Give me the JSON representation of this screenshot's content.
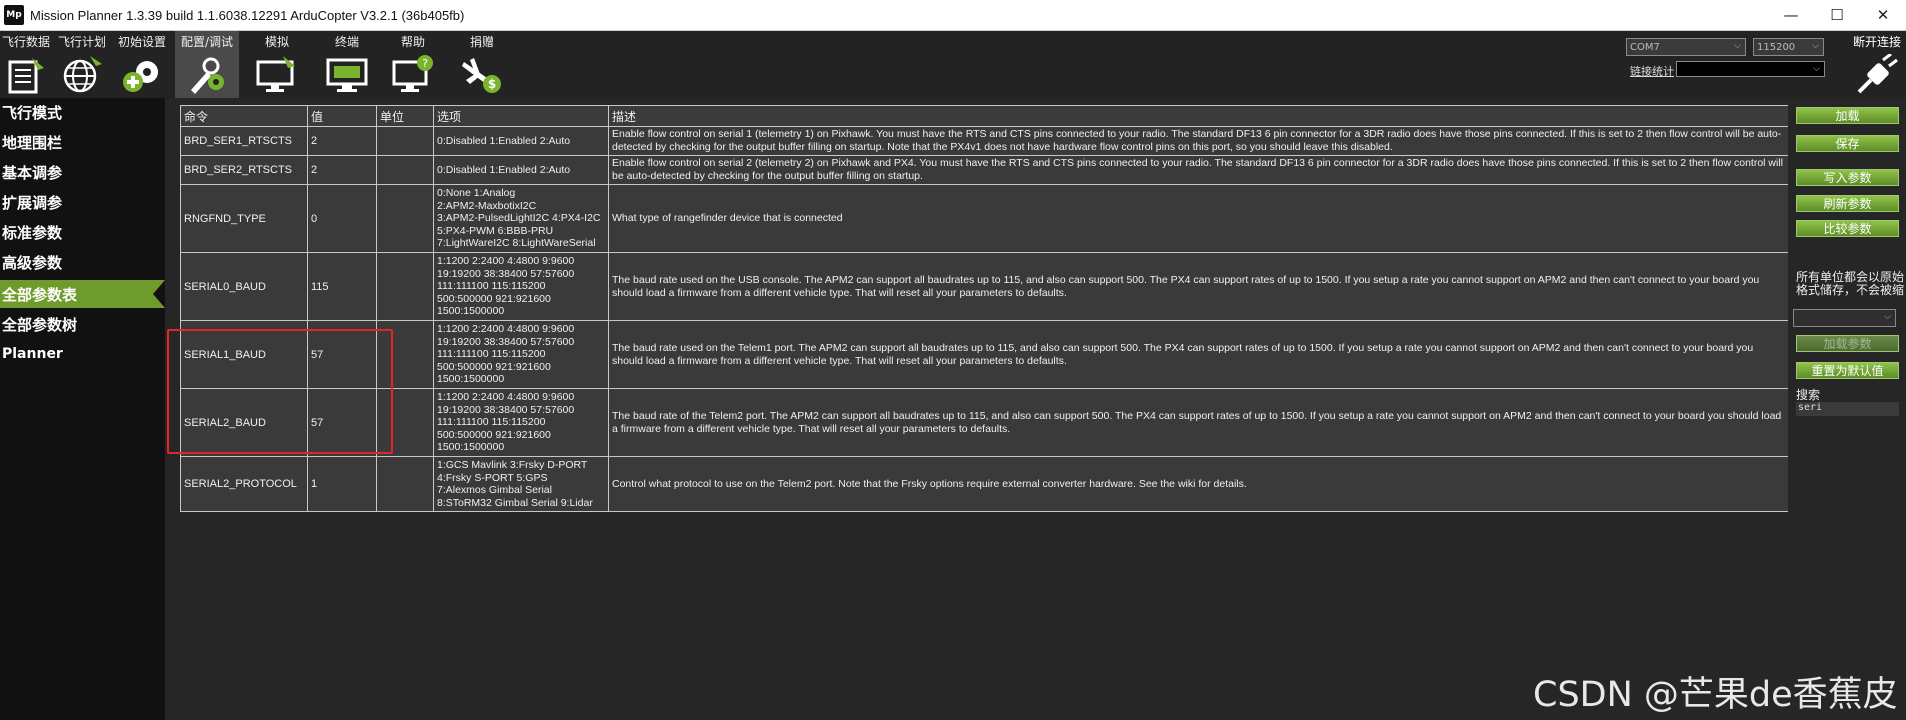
{
  "window": {
    "title": "Mission Planner 1.3.39 build 1.1.6038.12291 ArduCopter V3.2.1 (36b405fb)",
    "app_icon": "Mp",
    "minimize": "—",
    "maximize": "☐",
    "close": "✕"
  },
  "toolbar": {
    "items": [
      {
        "label": "飞行数据",
        "icon": "flight-data-icon"
      },
      {
        "label": "飞行计划",
        "icon": "globe-icon"
      },
      {
        "label": "初始设置",
        "icon": "gear-plus-icon"
      },
      {
        "label": "配置/调试",
        "icon": "wrench-gear-icon"
      },
      {
        "label": "模拟",
        "icon": "monitor-icon"
      },
      {
        "label": "终端",
        "icon": "terminal-icon"
      },
      {
        "label": "帮助",
        "icon": "help-monitor-icon"
      },
      {
        "label": "捐赠",
        "icon": "donate-plane-icon"
      }
    ],
    "active_index": 3,
    "com_port": "COM7",
    "baud_rate": "115200",
    "link_stats": "链接统计",
    "disconnect": "断开连接"
  },
  "sidebar": {
    "items": [
      "飞行模式",
      "地理围栏",
      "基本调参",
      "扩展调参",
      "标准参数",
      "高级参数",
      "全部参数表",
      "全部参数树",
      "Planner"
    ],
    "active_index": 6
  },
  "table": {
    "headers": [
      "命令",
      "值",
      "单位",
      "选项",
      "描述"
    ],
    "rows": [
      {
        "command": "BRD_SER1_RTSCTS",
        "value": "2",
        "unit": "",
        "options": [
          "0:Disabled 1:Enabled 2:Auto"
        ],
        "description": "Enable flow control on serial 1 (telemetry 1) on Pixhawk. You must have the RTS and CTS pins connected to your radio. The standard DF13 6 pin connector for a 3DR radio does have those pins connected. If this is set to 2 then flow control will be auto-detected by checking for the output buffer filling on startup. Note that the PX4v1 does not have hardware flow control pins on this port, so you should leave this disabled."
      },
      {
        "command": "BRD_SER2_RTSCTS",
        "value": "2",
        "unit": "",
        "options": [
          "0:Disabled 1:Enabled 2:Auto"
        ],
        "description": "Enable flow control on serial 2 (telemetry 2) on Pixhawk and PX4. You must have the RTS and CTS pins connected to your radio. The standard DF13 6 pin connector for a 3DR radio does have those pins connected. If this is set to 2 then flow control will be auto-detected by checking for the output buffer filling on startup."
      },
      {
        "command": "RNGFND_TYPE",
        "value": "0",
        "unit": "",
        "options": [
          "0:None 1:Analog",
          "2:APM2-MaxbotixI2C",
          "3:APM2-PulsedLightI2C 4:PX4-I2C",
          "5:PX4-PWM 6:BBB-PRU",
          "7:LightWareI2C 8:LightWareSerial"
        ],
        "description": "What type of rangefinder device that is connected"
      },
      {
        "command": "SERIAL0_BAUD",
        "value": "115",
        "unit": "",
        "options": [
          "1:1200 2:2400 4:4800 9:9600",
          "19:19200 38:38400 57:57600",
          "111:111100 115:115200",
          "500:500000 921:921600",
          "1500:1500000"
        ],
        "description": "The baud rate used on the USB console. The APM2 can support all baudrates up to 115, and also can support 500. The PX4 can support rates of up to 1500. If you setup a rate you cannot support on APM2 and then can't connect to your board you should load a firmware from a different vehicle type. That will reset all your parameters to defaults."
      },
      {
        "command": "SERIAL1_BAUD",
        "value": "57",
        "unit": "",
        "options": [
          "1:1200 2:2400 4:4800 9:9600",
          "19:19200 38:38400 57:57600",
          "111:111100 115:115200",
          "500:500000 921:921600",
          "1500:1500000"
        ],
        "description": "The baud rate used on the Telem1 port. The APM2 can support all baudrates up to 115, and also can support 500. The PX4 can support rates of up to 1500. If you setup a rate you cannot support on APM2 and then can't connect to your board you should load a firmware from a different vehicle type. That will reset all your parameters to defaults."
      },
      {
        "command": "SERIAL2_BAUD",
        "value": "57",
        "unit": "",
        "options": [
          "1:1200 2:2400 4:4800 9:9600",
          "19:19200 38:38400 57:57600",
          "111:111100 115:115200",
          "500:500000 921:921600",
          "1500:1500000"
        ],
        "description": "The baud rate of the Telem2 port. The APM2 can support all baudrates up to 115, and also can support 500. The PX4 can support rates of up to 1500. If you setup a rate you cannot support on APM2 and then can't connect to your board you should load a firmware from a different vehicle type. That will reset all your parameters to defaults."
      },
      {
        "command": "SERIAL2_PROTOCOL",
        "value": "1",
        "unit": "",
        "options": [
          "1:GCS Mavlink  3:Frsky D-PORT",
          "4:Frsky S-PORT  5:GPS",
          "7:Alexmos Gimbal Serial",
          "8:SToRM32 Gimbal Serial  9:Lidar"
        ],
        "description": "Control what protocol to use on the Telem2 port. Note that the Frsky options require external converter hardware. See the wiki for details."
      }
    ]
  },
  "right_panel": {
    "load": "加载",
    "save": "保存",
    "write_params": "写入参数",
    "refresh_params": "刷新参数",
    "compare_params": "比较参数",
    "units_note_1": "所有单位都会以原始",
    "units_note_2": "格式储存，不会被缩",
    "load_params": "加载参数",
    "reset_default": "重置为默认值",
    "search_label": "搜索",
    "search_value": "seri"
  },
  "watermark": "CSDN @芒果de香蕉皮",
  "colors": {
    "accent_green": "#6f9b2c",
    "highlight_red": "#e0252b",
    "background": "#262626"
  }
}
